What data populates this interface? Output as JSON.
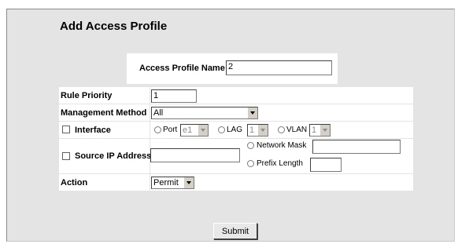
{
  "title": "Add Access Profile",
  "profile_name": {
    "label": "Access Profile Name",
    "value": "2"
  },
  "rule_priority": {
    "label": "Rule Priority",
    "value": "1"
  },
  "management_method": {
    "label": "Management Method",
    "value": "All"
  },
  "interface": {
    "label": "Interface",
    "port_label": "Port",
    "port_value": "e1",
    "lag_label": "LAG",
    "lag_value": "1",
    "vlan_label": "VLAN",
    "vlan_value": "1"
  },
  "source_ip": {
    "label": "Source IP Address",
    "value": "",
    "network_mask_label": "Network Mask",
    "network_mask_value": "",
    "prefix_length_label": "Prefix Length",
    "prefix_length_value": ""
  },
  "action": {
    "label": "Action",
    "value": "Permit"
  },
  "submit_label": "Submit"
}
